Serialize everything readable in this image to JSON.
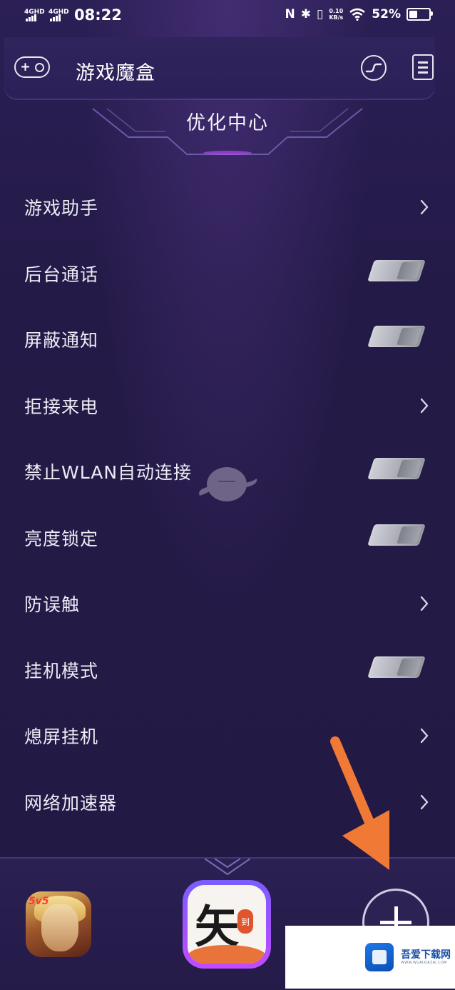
{
  "status_bar": {
    "net1": "4GHD",
    "net2": "4GHD",
    "time": "08:22",
    "speed_value": "0.10",
    "speed_unit": "KB/s",
    "battery": "52%",
    "battery_level": 0.52
  },
  "header": {
    "title": "游戏魔盒",
    "icons": [
      "gamepad-icon",
      "performance-icon",
      "notes-icon"
    ]
  },
  "section": {
    "title": "优化中心"
  },
  "items": [
    {
      "label": "游戏助手",
      "control": "chevron"
    },
    {
      "label": "后台通话",
      "control": "toggle",
      "on": false
    },
    {
      "label": "屏蔽通知",
      "control": "toggle",
      "on": false
    },
    {
      "label": "拒接来电",
      "control": "chevron"
    },
    {
      "label": "禁止WLAN自动连接",
      "control": "toggle",
      "on": false
    },
    {
      "label": "亮度锁定",
      "control": "toggle",
      "on": false
    },
    {
      "label": "防误触",
      "control": "chevron"
    },
    {
      "label": "挂机模式",
      "control": "toggle",
      "on": false
    },
    {
      "label": "熄屏挂机",
      "control": "chevron"
    },
    {
      "label": "网络加速器",
      "control": "chevron"
    }
  ],
  "dock": {
    "apps": [
      "game-app-icon",
      "arrow-app-icon",
      "add-app-button"
    ],
    "app1_badge": "5v5"
  },
  "watermark": {
    "name": "吾爱下载网",
    "url": "WWW.WUAIXIAZAI.COM"
  },
  "colors": {
    "background": "#231a44",
    "header": "#2d2259",
    "text": "#ecebf4",
    "accent": "#c04cff",
    "arrow": "#f07a35"
  }
}
